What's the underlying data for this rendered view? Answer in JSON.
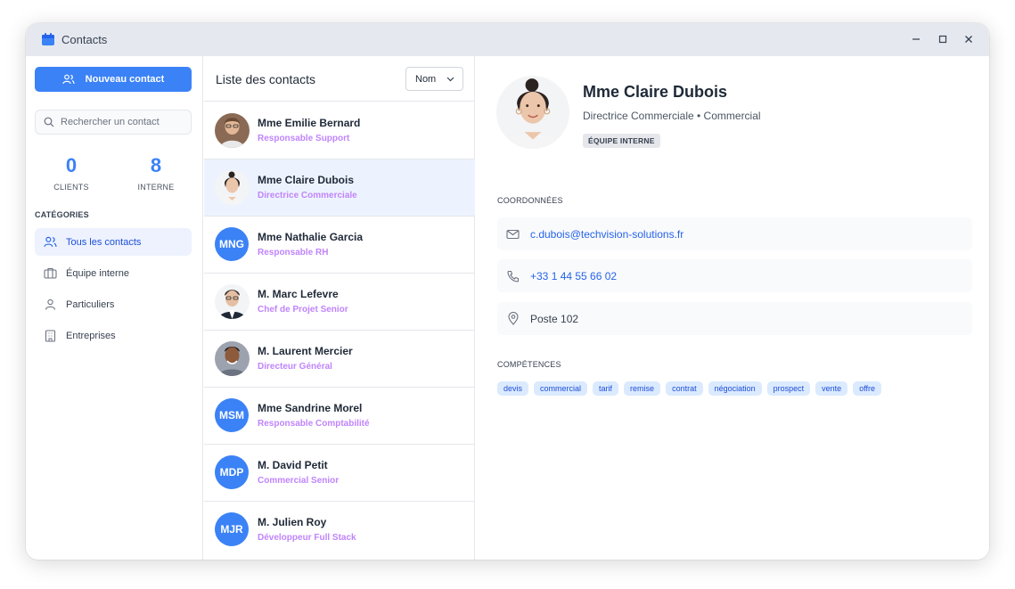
{
  "window": {
    "title": "Contacts"
  },
  "sidebar": {
    "new_contact_label": "Nouveau contact",
    "search_placeholder": "Rechercher un contact",
    "stats": [
      {
        "value": "0",
        "label": "CLIENTS"
      },
      {
        "value": "8",
        "label": "INTERNE"
      }
    ],
    "categories_heading": "CATÉGORIES",
    "categories": [
      {
        "label": "Tous les contacts",
        "icon": "users-icon",
        "active": true
      },
      {
        "label": "Équipe interne",
        "icon": "briefcase-icon",
        "active": false
      },
      {
        "label": "Particuliers",
        "icon": "user-icon",
        "active": false
      },
      {
        "label": "Entreprises",
        "icon": "building-icon",
        "active": false
      }
    ]
  },
  "list": {
    "title": "Liste des contacts",
    "sort_value": "Nom",
    "contacts": [
      {
        "name": "Mme Emilie Bernard",
        "role": "Responsable Support",
        "avatar": "photo",
        "selected": false
      },
      {
        "name": "Mme Claire Dubois",
        "role": "Directrice Commerciale",
        "avatar": "photo",
        "selected": true
      },
      {
        "name": "Mme Nathalie Garcia",
        "role": "Responsable RH",
        "avatar": "MNG",
        "selected": false
      },
      {
        "name": "M. Marc Lefevre",
        "role": "Chef de Projet Senior",
        "avatar": "photo",
        "selected": false
      },
      {
        "name": "M. Laurent Mercier",
        "role": "Directeur Général",
        "avatar": "photo",
        "selected": false
      },
      {
        "name": "Mme Sandrine Morel",
        "role": "Responsable Comptabilité",
        "avatar": "MSM",
        "selected": false
      },
      {
        "name": "M. David Petit",
        "role": "Commercial Senior",
        "avatar": "MDP",
        "selected": false
      },
      {
        "name": "M. Julien Roy",
        "role": "Développeur Full Stack",
        "avatar": "MJR",
        "selected": false
      }
    ]
  },
  "detail": {
    "name": "Mme Claire Dubois",
    "subtitle": "Directrice Commerciale • Commercial",
    "badge": "ÉQUIPE INTERNE",
    "coords_heading": "COORDONNÉES",
    "email": "c.dubois@techvision-solutions.fr",
    "phone": "+33 1 44 55 66 02",
    "extension": "Poste 102",
    "skills_heading": "COMPÉTENCES",
    "skills": [
      "devis",
      "commercial",
      "tarif",
      "remise",
      "contrat",
      "négociation",
      "prospect",
      "vente",
      "offre"
    ]
  },
  "colors": {
    "accent": "#3b82f6",
    "role_text": "#c084fc",
    "selected_row": "#edf3fe",
    "tag_bg": "#dbeafe"
  }
}
